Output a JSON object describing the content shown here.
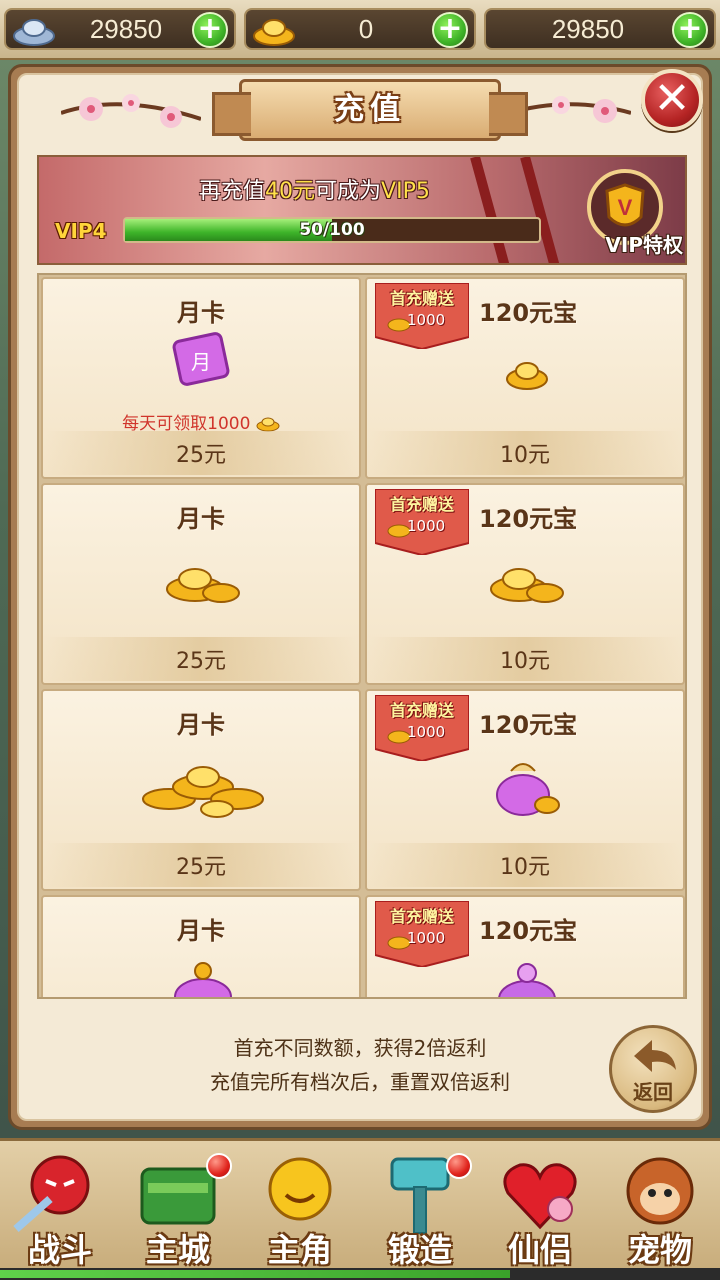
{
  "currency": {
    "silver": "29850",
    "gold": "0",
    "third": "29850"
  },
  "panel": {
    "title": "充值"
  },
  "vip": {
    "message_prefix": "再充值",
    "message_amount": "40元",
    "message_middle": "可成为",
    "message_target": "VIP5",
    "level": "VIP4",
    "progress_text": "50/100",
    "progress_fraction": 0.5,
    "privilege_label": "VIP特权"
  },
  "cards": {
    "left": [
      {
        "title": "月卡",
        "note": "每天可领取1000",
        "price": "25元",
        "icon": "monthly-card-icon"
      },
      {
        "title": "月卡",
        "note": "",
        "price": "25元",
        "icon": "gold-ingot-pile-small-icon"
      },
      {
        "title": "月卡",
        "note": "",
        "price": "25元",
        "icon": "gold-ingot-pile-large-icon"
      },
      {
        "title": "月卡",
        "note": "",
        "price": "",
        "icon": "treasure-bag-icon"
      }
    ],
    "right": [
      {
        "bonus_label": "首充赠送",
        "bonus_value": "1000",
        "title": "120元宝",
        "price": "10元",
        "icon": "gold-ingot-icon"
      },
      {
        "bonus_label": "首充赠送",
        "bonus_value": "1000",
        "title": "120元宝",
        "price": "10元",
        "icon": "gold-ingot-pile-small-icon"
      },
      {
        "bonus_label": "首充赠送",
        "bonus_value": "1000",
        "title": "120元宝",
        "price": "10元",
        "icon": "treasure-bag-icon"
      },
      {
        "bonus_label": "首充赠送",
        "bonus_value": "1000",
        "title": "120元宝",
        "price": "",
        "icon": "treasure-bag-icon"
      }
    ]
  },
  "footer": {
    "line1": "首充不同数额，获得2倍返利",
    "line2": "充值完所有档次后，重置双倍返利",
    "back_label": "返回"
  },
  "nav": [
    {
      "label": "战斗",
      "icon": "battle-icon",
      "badge": false
    },
    {
      "label": "主城",
      "icon": "city-icon",
      "badge": true
    },
    {
      "label": "主角",
      "icon": "hero-icon",
      "badge": false
    },
    {
      "label": "锻造",
      "icon": "forge-hammer-icon",
      "badge": true
    },
    {
      "label": "仙侣",
      "icon": "companion-heart-icon",
      "badge": false
    },
    {
      "label": "宠物",
      "icon": "pet-monkey-icon",
      "badge": false
    }
  ],
  "colors": {
    "accent_red": "#d0352c",
    "highlight_yellow": "#ffe14a",
    "progress_green": "#3eb52a"
  }
}
